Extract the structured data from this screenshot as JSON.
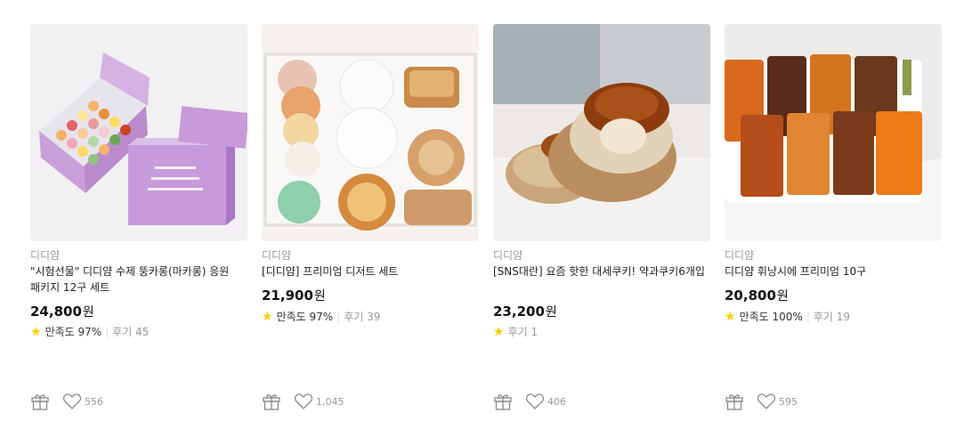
{
  "products": [
    {
      "image": "purple macaron gift box",
      "brand": "디디얌",
      "title": "\"시험선물\" 디디얌 수제 뚱카롱(마카롱) 응원 패키지 12구 세트",
      "price": "24,800",
      "currency": "원",
      "satisfaction_label": "만족도",
      "satisfaction": "97%",
      "review_label": "후기",
      "review_count": "45",
      "likes": "556"
    },
    {
      "image": "premium dessert set box",
      "brand": "디디얌",
      "title": "[디디얌] 프리미엄 디저트 세트",
      "price": "21,900",
      "currency": "원",
      "satisfaction_label": "만족도",
      "satisfaction": "97%",
      "review_label": "후기",
      "review_count": "39",
      "likes": "1,045"
    },
    {
      "image": "yakgwa cookie cut in half",
      "brand": "디디얌",
      "title": "[SNS대란] 요즘 핫한 대세쿠키! 약과쿠키6개입",
      "price": "23,200",
      "currency": "원",
      "review_label": "후기",
      "review_count": "1",
      "likes": "406"
    },
    {
      "image": "financier 10 pieces on tray",
      "brand": "디디얌",
      "title": "디디얌 휘낭시에 프리미엄 10구",
      "price": "20,800",
      "currency": "원",
      "satisfaction_label": "만족도",
      "satisfaction": "100%",
      "review_label": "후기",
      "review_count": "19",
      "likes": "595"
    }
  ],
  "icons": {
    "rating": "star-icon",
    "gift": "gift-icon",
    "wishlist": "heart-icon"
  },
  "colors": {
    "star": "#f8d000",
    "muted": "#999999",
    "text": "#222222"
  }
}
